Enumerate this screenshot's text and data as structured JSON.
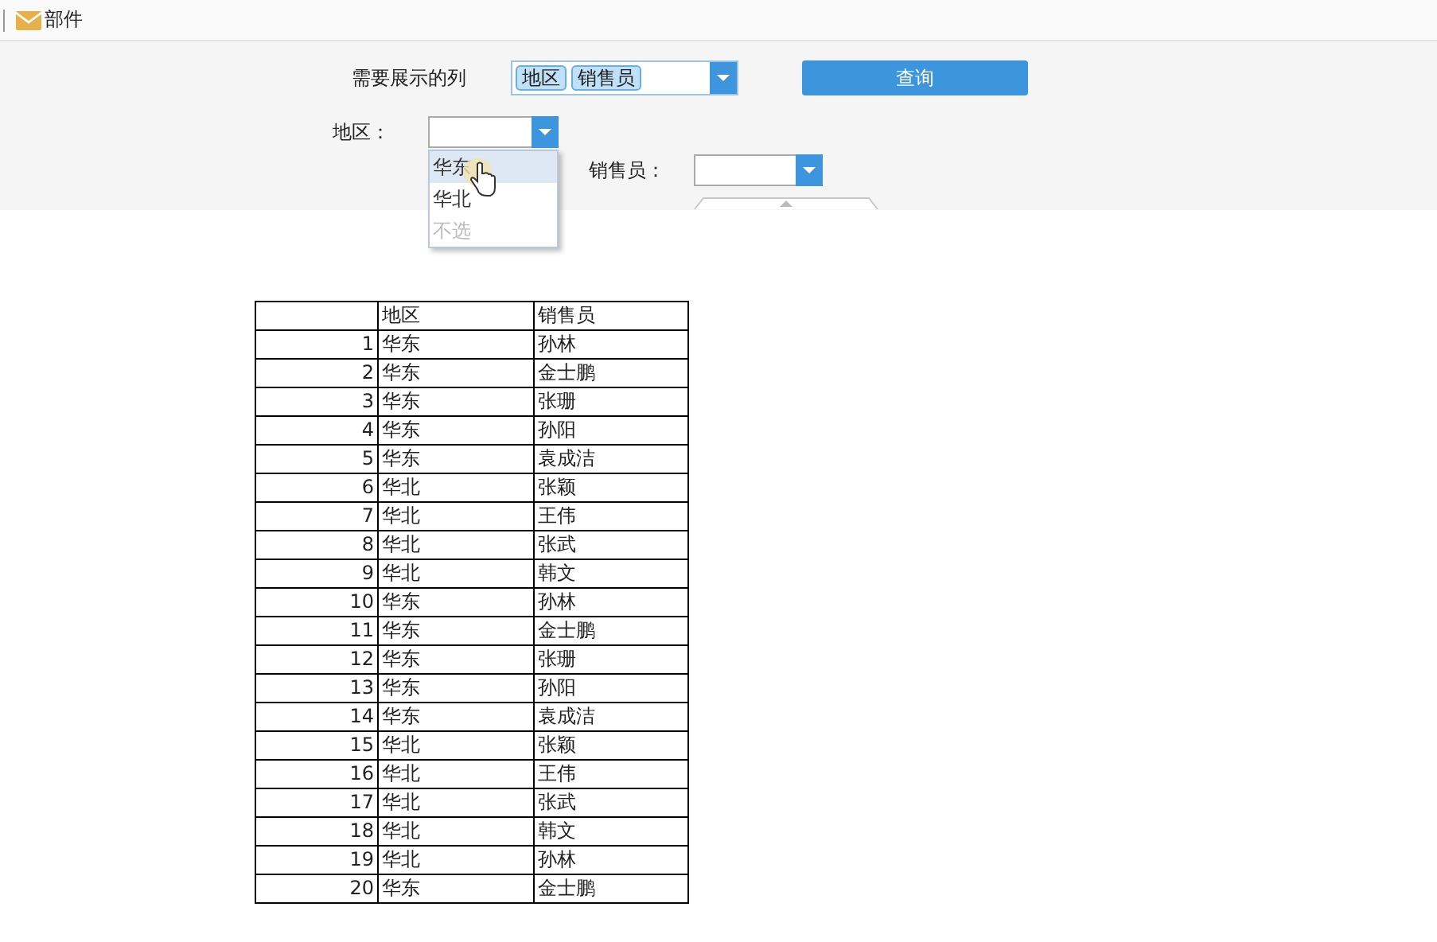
{
  "tab": {
    "label": "部件"
  },
  "columns_filter": {
    "label": "需要展示的列",
    "tags": [
      "地区",
      "销售员"
    ]
  },
  "query_button": {
    "label": "查询"
  },
  "region_filter": {
    "label": "地区：",
    "open": true,
    "options": [
      {
        "label": "华东",
        "selected": true,
        "disabled": false
      },
      {
        "label": "华北",
        "selected": false,
        "disabled": false
      },
      {
        "label": "不选",
        "selected": false,
        "disabled": true
      }
    ]
  },
  "salesperson_filter": {
    "label": "销售员："
  },
  "table": {
    "columns": [
      "地区",
      "销售员"
    ],
    "rows": [
      {
        "index": "1",
        "region": "华东",
        "name": "孙林"
      },
      {
        "index": "2",
        "region": "华东",
        "name": "金士鹏"
      },
      {
        "index": "3",
        "region": "华东",
        "name": "张珊"
      },
      {
        "index": "4",
        "region": "华东",
        "name": "孙阳"
      },
      {
        "index": "5",
        "region": "华东",
        "name": "袁成洁"
      },
      {
        "index": "6",
        "region": "华北",
        "name": "张颖"
      },
      {
        "index": "7",
        "region": "华北",
        "name": "王伟"
      },
      {
        "index": "8",
        "region": "华北",
        "name": "张武"
      },
      {
        "index": "9",
        "region": "华北",
        "name": "韩文"
      },
      {
        "index": "10",
        "region": "华东",
        "name": "孙林"
      },
      {
        "index": "11",
        "region": "华东",
        "name": "金士鹏"
      },
      {
        "index": "12",
        "region": "华东",
        "name": "张珊"
      },
      {
        "index": "13",
        "region": "华东",
        "name": "孙阳"
      },
      {
        "index": "14",
        "region": "华东",
        "name": "袁成洁"
      },
      {
        "index": "15",
        "region": "华北",
        "name": "张颖"
      },
      {
        "index": "16",
        "region": "华北",
        "name": "王伟"
      },
      {
        "index": "17",
        "region": "华北",
        "name": "张武"
      },
      {
        "index": "18",
        "region": "华北",
        "name": "韩文"
      },
      {
        "index": "19",
        "region": "华北",
        "name": "孙林"
      },
      {
        "index": "20",
        "region": "华东",
        "name": "金士鹏"
      }
    ]
  }
}
